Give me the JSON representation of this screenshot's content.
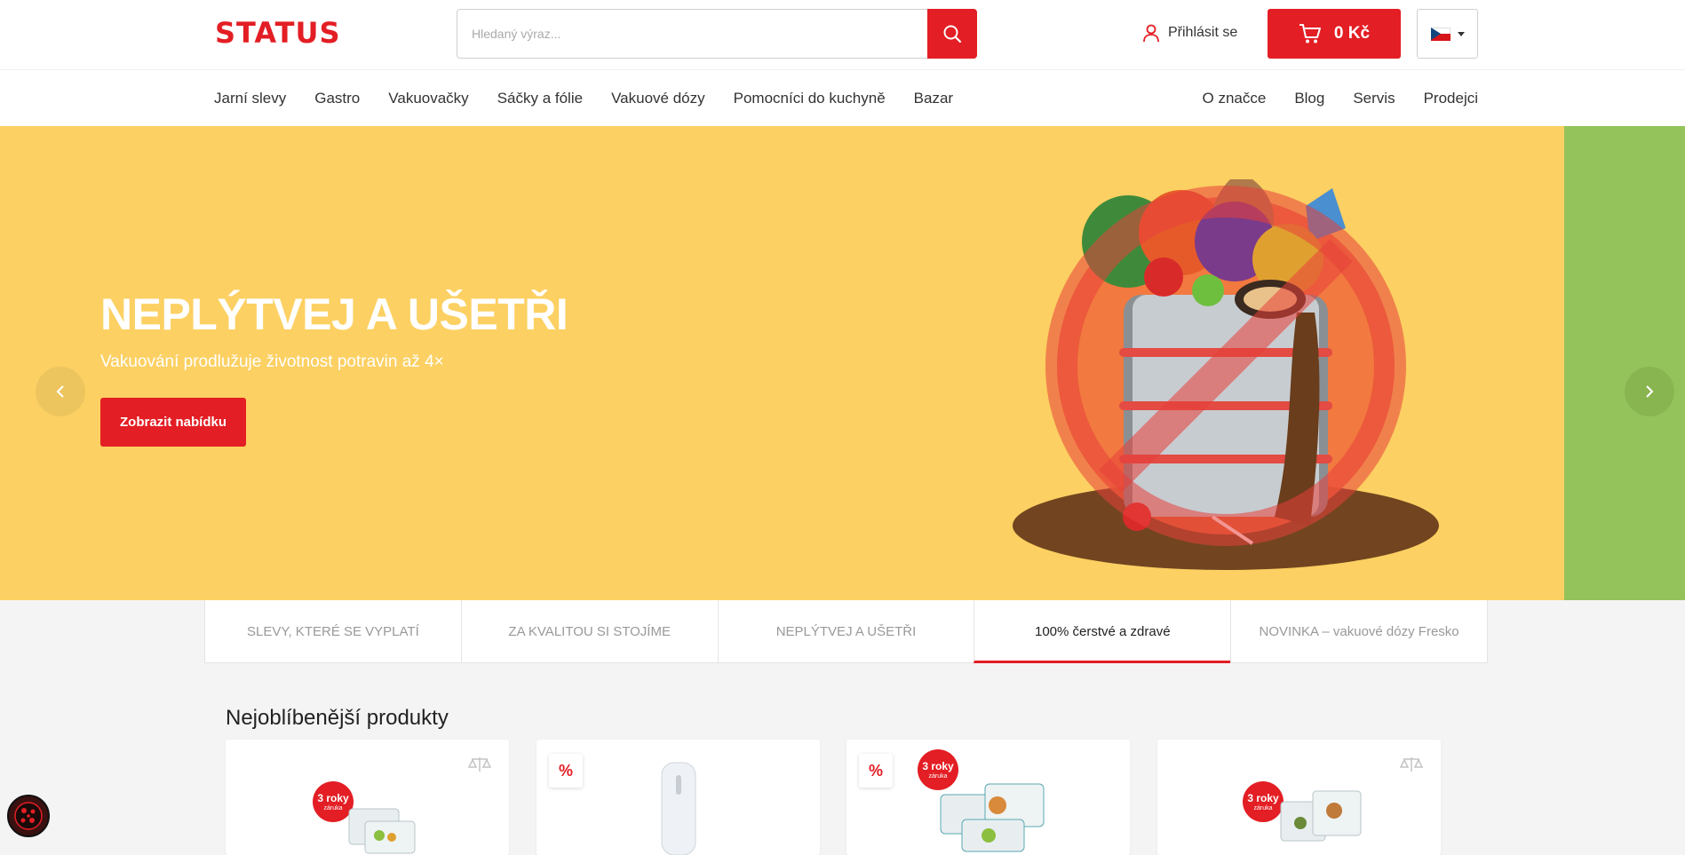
{
  "header": {
    "logo": "STATUS",
    "search_placeholder": "Hledaný výraz...",
    "login_label": "Přihlásit se",
    "cart_total": "0 Kč",
    "language": "CZ"
  },
  "nav": {
    "left": [
      "Jarní slevy",
      "Gastro",
      "Vakuovačky",
      "Sáčky a fólie",
      "Vakuové dózy",
      "Pomocníci do kuchyně",
      "Bazar"
    ],
    "right": [
      "O značce",
      "Blog",
      "Servis",
      "Prodejci"
    ]
  },
  "hero": {
    "title": "NEPLÝTVEJ A UŠETŘI",
    "subtitle": "Vakuování prodlužuje životnost potravin až 4×",
    "button": "Zobrazit nabídku",
    "background_color": "#fcd062",
    "next_slide_color": "#94c35c"
  },
  "tabs": {
    "items": [
      "SLEVY, KTERÉ SE VYPLATÍ",
      "ZA KVALITOU SI STOJÍME",
      "NEPLÝTVEJ A UŠETŘI",
      "100% čerstvé a zdravé",
      "NOVINKA – vakuové dózy Fresko"
    ],
    "active_index": 3
  },
  "products": {
    "title": "Nejoblíbenější produkty",
    "badge_line1": "3 roky",
    "badge_line2": "záruka",
    "discount_symbol": "%"
  },
  "colors": {
    "accent": "#e31e24",
    "text": "#222222"
  }
}
